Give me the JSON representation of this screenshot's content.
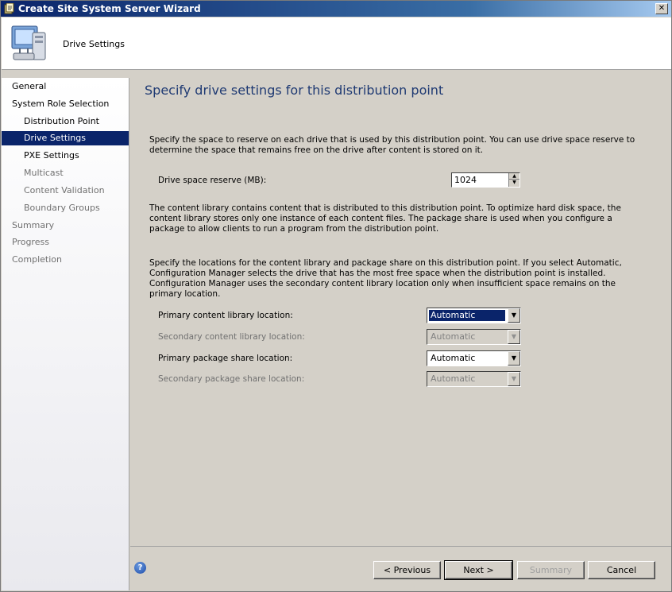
{
  "window": {
    "title": "Create Site System Server Wizard",
    "close_glyph": "✕"
  },
  "header": {
    "page_name": "Drive Settings",
    "icon": "computer-icon"
  },
  "sidebar": {
    "items": [
      {
        "label": "General",
        "level": 1,
        "state": "normal"
      },
      {
        "label": "System Role Selection",
        "level": 1,
        "state": "normal"
      },
      {
        "label": "Distribution Point",
        "level": 2,
        "state": "normal"
      },
      {
        "label": "Drive Settings",
        "level": 2,
        "state": "active"
      },
      {
        "label": "PXE Settings",
        "level": 2,
        "state": "normal"
      },
      {
        "label": "Multicast",
        "level": 2,
        "state": "muted"
      },
      {
        "label": "Content Validation",
        "level": 2,
        "state": "muted"
      },
      {
        "label": "Boundary Groups",
        "level": 2,
        "state": "muted"
      },
      {
        "label": "Summary",
        "level": 1,
        "state": "muted"
      },
      {
        "label": "Progress",
        "level": 1,
        "state": "muted"
      },
      {
        "label": "Completion",
        "level": 1,
        "state": "muted"
      }
    ]
  },
  "main": {
    "heading": "Specify drive settings for this distribution point",
    "intro": "Specify the space to reserve on each drive that is used by this distribution point. You can use drive space reserve to determine the space that remains free on the drive after content is stored on it.",
    "reserve_label": "Drive space reserve (MB):",
    "reserve_value": "1024",
    "library_text": "The content library contains content that is distributed to this distribution point. To optimize hard disk space, the content library stores only one instance of each content files. The package share is used when you configure a package to allow clients to run a program from the distribution point.",
    "locations_text": "Specify the locations for the content library and package share on this distribution point. If you select Automatic, Configuration Manager selects the drive that has the most free space when the distribution point is installed. Configuration Manager uses the secondary content library location only when insufficient space remains on the primary location.",
    "locations": [
      {
        "label": "Primary content library location:",
        "value": "Automatic",
        "enabled": true,
        "selected": true
      },
      {
        "label": "Secondary content library location:",
        "value": "Automatic",
        "enabled": false,
        "selected": false
      },
      {
        "label": "Primary package share location:",
        "value": "Automatic",
        "enabled": true,
        "selected": false
      },
      {
        "label": "Secondary package share location:",
        "value": "Automatic",
        "enabled": false,
        "selected": false
      }
    ]
  },
  "footer": {
    "previous_label": "< Previous",
    "next_label": "Next >",
    "summary_label": "Summary",
    "cancel_label": "Cancel",
    "summary_enabled": false
  },
  "colors": {
    "accent": "#0a246a",
    "heading": "#1f3a73"
  }
}
